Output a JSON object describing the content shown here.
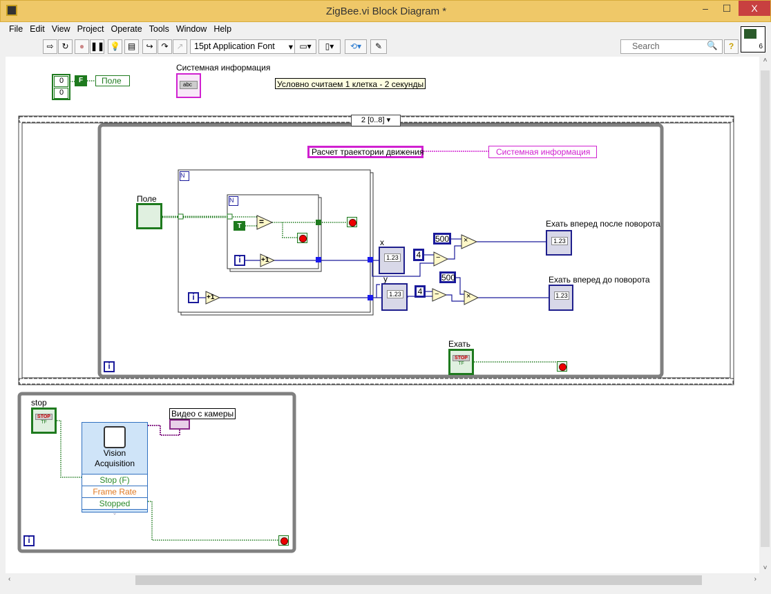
{
  "window": {
    "title": "ZigBee.vi Block Diagram *",
    "minimize": "–",
    "maximize": "☐",
    "close": "X"
  },
  "menu": [
    "File",
    "Edit",
    "View",
    "Project",
    "Operate",
    "Tools",
    "Window",
    "Help"
  ],
  "toolbar": {
    "font": "15pt Application Font",
    "search_placeholder": "Search",
    "connector_pane_number": "6"
  },
  "diagram": {
    "cluster_values": [
      "0",
      "0"
    ],
    "bool_const": "F",
    "local_pole": "Поле",
    "sys_info_label": "Системная информация",
    "sys_info_type": "abc",
    "comment": "Условно считаем 1 клетка - 2 секунды",
    "sequence_selector": "2 [0..8]",
    "string_const": "Расчет траектории движения",
    "local_sys_info": "Системная информация",
    "pole_label": "Поле",
    "true_const": "T",
    "increment": "+1",
    "iteration": "i",
    "x_label": "x",
    "y_label": "y",
    "num_display": "1.23",
    "num_type": "I32",
    "const_4a": "4",
    "const_4b": "4",
    "const_500a": "500",
    "const_500b": "500",
    "subtract": "−",
    "multiply": "×",
    "equal": "=",
    "out1_label": "Ехать вперед после поворота",
    "out2_label": "Ехать вперед до поворота",
    "go_label": "Ехать",
    "stop_text": "STOP",
    "tf": "TF",
    "stop_label": "stop",
    "vision": {
      "title": "Vision Acquisition",
      "rows": [
        {
          "label": "Stop (F)",
          "color": "#2a8a2a"
        },
        {
          "label": "Frame Rate",
          "color": "#e07820"
        },
        {
          "label": "Stopped",
          "color": "#2a8a2a"
        }
      ]
    },
    "video_label": "Видео с камеры"
  },
  "colors": {
    "titlebar": "#efc868",
    "int_wire": "#1a1a9a",
    "bool_wire": "#1e7a1e",
    "string_wire": "#d020d0",
    "loop": "#808080"
  }
}
